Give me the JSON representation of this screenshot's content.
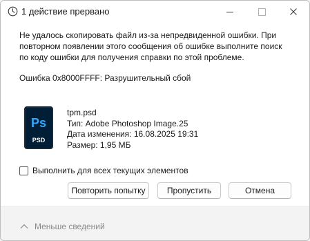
{
  "window": {
    "title": "1 действие прервано",
    "icons": {
      "title": "clock-icon",
      "minimize": "minimize-icon",
      "maximize": "maximize-icon",
      "close": "close-icon"
    }
  },
  "message": {
    "text": "Не удалось скопировать файл из-за непредвиденной ошибки. При повторном появлении этого сообщения об ошибке выполните поиск по коду ошибки для получения справки по этой проблеме.",
    "error": "Ошибка 0x8000FFFF: Разрушительный сбой"
  },
  "file": {
    "icon": "photoshop-file-icon",
    "icon_badge": "Ps",
    "icon_label": "PSD",
    "name": "tpm.psd",
    "type": "Тип: Adobe Photoshop Image.25",
    "modified": "Дата изменения: 16.08.2025 19:31",
    "size": "Размер: 1,95 МБ"
  },
  "checkbox": {
    "label": "Выполнить для всех текущих элементов",
    "checked": false
  },
  "buttons": {
    "retry": "Повторить попытку",
    "skip": "Пропустить",
    "cancel": "Отмена"
  },
  "footer": {
    "less_details": "Меньше сведений",
    "icon": "chevron-up-icon"
  },
  "colors": {
    "ps_dark": "#001e36",
    "ps_blue": "#31a8ff",
    "window_bg": "#f3f3f3",
    "content_bg": "#ffffff"
  }
}
